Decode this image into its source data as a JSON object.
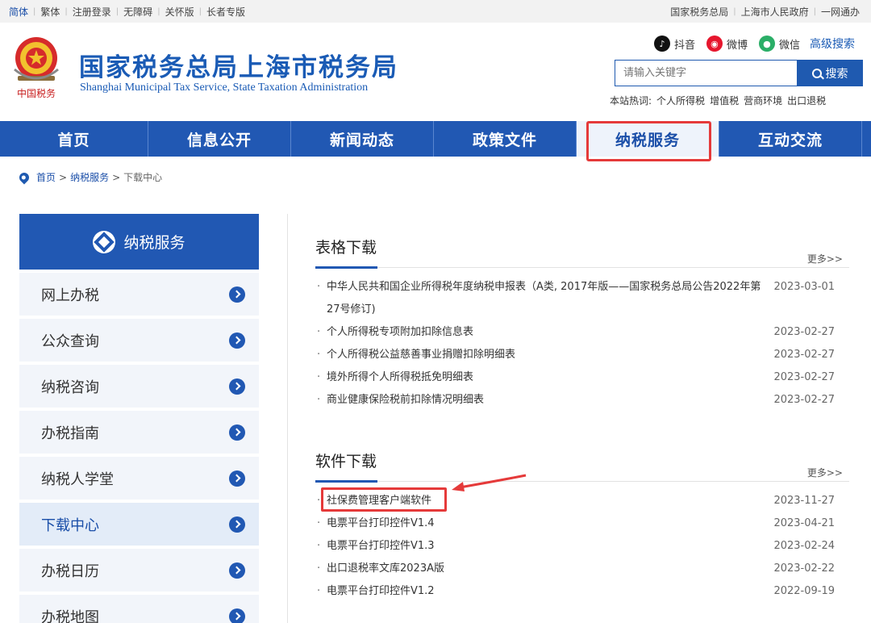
{
  "topbar": {
    "left": [
      "简体",
      "繁体",
      "注册登录",
      "无障碍",
      "关怀版",
      "长者专版"
    ],
    "right": [
      "国家税务总局",
      "上海市人民政府",
      "一网通办"
    ]
  },
  "header": {
    "emblem_caption": "中国税务",
    "title_cn": "国家税务总局上海市税务局",
    "title_en": "Shanghai Municipal Tax Service, State Taxation Administration",
    "social": [
      {
        "icon": "douyin-icon",
        "label": "抖音",
        "color": "#111111",
        "glyph": "♪"
      },
      {
        "icon": "weibo-icon",
        "label": "微博",
        "color": "#e6162d",
        "glyph": "◉"
      },
      {
        "icon": "wechat-icon",
        "label": "微信",
        "color": "#2aae67",
        "glyph": "●"
      }
    ],
    "advanced_search": "高级搜索",
    "search_placeholder": "请输入关键字",
    "search_button": "搜索",
    "hot_label": "本站热词:",
    "hot_words": [
      "个人所得税",
      "增值税",
      "营商环境",
      "出口退税"
    ]
  },
  "nav": [
    "首页",
    "信息公开",
    "新闻动态",
    "政策文件",
    "纳税服务",
    "互动交流"
  ],
  "nav_active": "纳税服务",
  "breadcrumb": {
    "home": "首页",
    "parent": "纳税服务",
    "current": "下载中心",
    "sep": ">"
  },
  "sidebar": {
    "title": "纳税服务",
    "items": [
      "网上办税",
      "公众查询",
      "纳税咨询",
      "办税指南",
      "纳税人学堂",
      "下载中心",
      "办税日历",
      "办税地图"
    ],
    "active": "下载中心"
  },
  "sections": [
    {
      "title": "表格下载",
      "more": "更多>>",
      "rows": [
        {
          "text": "中华人民共和国企业所得税年度纳税申报表（A类, 2017年版——国家税务总局公告2022年第27号修订)",
          "date": "2023-03-01"
        },
        {
          "text": "个人所得税专项附加扣除信息表",
          "date": "2023-02-27"
        },
        {
          "text": "个人所得税公益慈善事业捐赠扣除明细表",
          "date": "2023-02-27"
        },
        {
          "text": "境外所得个人所得税抵免明细表",
          "date": "2023-02-27"
        },
        {
          "text": "商业健康保险税前扣除情况明细表",
          "date": "2023-02-27"
        }
      ]
    },
    {
      "title": "软件下载",
      "more": "更多>>",
      "rows": [
        {
          "text": "社保费管理客户端软件",
          "date": "2023-11-27"
        },
        {
          "text": "电票平台打印控件V1.4",
          "date": "2023-04-21"
        },
        {
          "text": "电票平台打印控件V1.3",
          "date": "2023-02-24"
        },
        {
          "text": "出口退税率文库2023A版",
          "date": "2023-02-22"
        },
        {
          "text": "电票平台打印控件V1.2",
          "date": "2022-09-19"
        }
      ]
    }
  ],
  "bullet": "·",
  "colors": {
    "brand_blue": "#2158b3",
    "highlight_red": "#e53a3a"
  }
}
